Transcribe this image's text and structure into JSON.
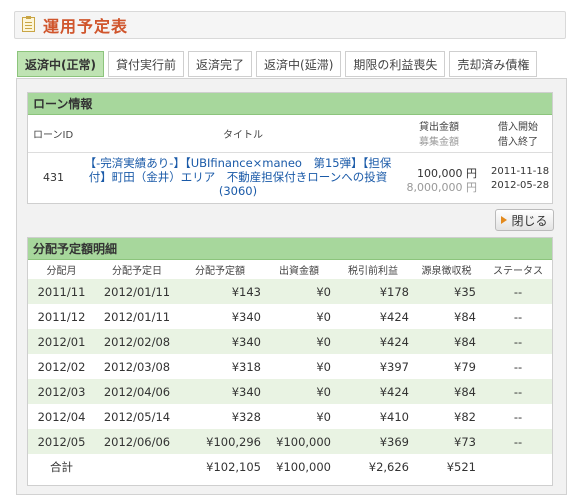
{
  "page": {
    "title": "運用予定表",
    "icon": "memo-icon"
  },
  "tabs": [
    {
      "label": "返済中(正常)",
      "active": true
    },
    {
      "label": "貸付実行前"
    },
    {
      "label": "返済完了"
    },
    {
      "label": "返済中(延滞)"
    },
    {
      "label": "期限の利益喪失"
    },
    {
      "label": "売却済み債権"
    }
  ],
  "loan_info": {
    "heading": "ローン情報",
    "headers": {
      "loan_id": "ローンID",
      "title": "タイトル",
      "loan_amount": "貸出金額",
      "raise_amount": "募集金額",
      "borrow_start": "借入開始",
      "borrow_end": "借入終了"
    },
    "row": {
      "loan_id": "431",
      "title_line1": "【-完済実績あり-】【UBIfinance×maneo　第15弾】【担保",
      "title_line2": "付】町田（金井）エリア　不動産担保付きローンへの投資",
      "title_line3": "(3060)",
      "loan_amount": "100,000 円",
      "raise_amount": "8,000,000 円",
      "borrow_start": "2011-11-18",
      "borrow_end": "2012-05-28"
    }
  },
  "close_button": {
    "label": "閉じる",
    "icon": "arrow-right-icon"
  },
  "distribution": {
    "heading": "分配予定額明細",
    "columns": [
      "分配月",
      "分配予定日",
      "分配予定額",
      "出資金額",
      "税引前利益",
      "源泉徴収税",
      "ステータス"
    ],
    "rows": [
      [
        "2011/11",
        "2012/01/11",
        "¥143",
        "¥0",
        "¥178",
        "¥35",
        "--"
      ],
      [
        "2011/12",
        "2012/01/11",
        "¥340",
        "¥0",
        "¥424",
        "¥84",
        "--"
      ],
      [
        "2012/01",
        "2012/02/08",
        "¥340",
        "¥0",
        "¥424",
        "¥84",
        "--"
      ],
      [
        "2012/02",
        "2012/03/08",
        "¥318",
        "¥0",
        "¥397",
        "¥79",
        "--"
      ],
      [
        "2012/03",
        "2012/04/06",
        "¥340",
        "¥0",
        "¥424",
        "¥84",
        "--"
      ],
      [
        "2012/04",
        "2012/05/14",
        "¥328",
        "¥0",
        "¥410",
        "¥82",
        "--"
      ],
      [
        "2012/05",
        "2012/06/06",
        "¥100,296",
        "¥100,000",
        "¥369",
        "¥73",
        "--"
      ]
    ],
    "total": [
      "合計",
      "",
      "¥102,105",
      "¥100,000",
      "¥2,626",
      "¥521",
      ""
    ]
  }
}
